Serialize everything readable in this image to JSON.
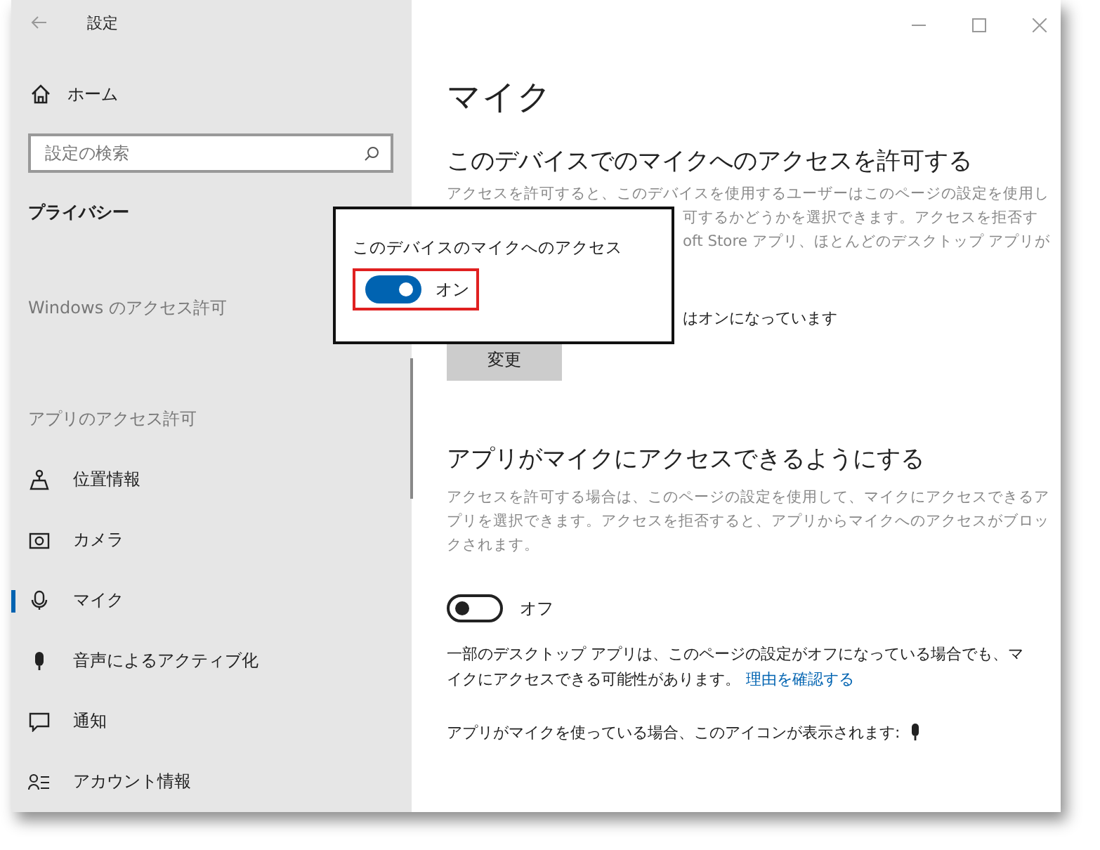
{
  "window": {
    "title": "設定"
  },
  "sidebar": {
    "home": "ホーム",
    "search": {
      "placeholder": "設定の検索"
    },
    "section": "プライバシー",
    "group_1": "Windows のアクセス許可",
    "group_2": "アプリのアクセス許可",
    "items": [
      {
        "label": "位置情報",
        "selected": false
      },
      {
        "label": "カメラ",
        "selected": false
      },
      {
        "label": "マイク",
        "selected": true
      },
      {
        "label": "音声によるアクティブ化",
        "selected": false
      },
      {
        "label": "通知",
        "selected": false
      },
      {
        "label": "アカウント情報",
        "selected": false
      }
    ]
  },
  "main": {
    "title": "マイク",
    "section_1": {
      "heading": "このデバイスでのマイクへのアクセスを許可する",
      "visible_lines": [
        "アクセスを許可すると、このデバイスを使用するユーザーはこのページの設定を使用し",
        "可するかどうかを選択できます。アクセスを拒否す",
        "oft Store アプリ、ほとんどのデスクトップ アプリが"
      ],
      "status": "はオンになっています",
      "button": "変更"
    },
    "section_2": {
      "heading": "アプリがマイクにアクセスできるようにする",
      "description": "アクセスを許可する場合は、このページの設定を使用して、マイクにアクセスできるアプリを選択できます。アクセスを拒否すると、アプリからマイクへのアクセスがブロックされます。",
      "toggle": {
        "on": false,
        "label": "オフ"
      },
      "note": "一部のデスクトップ アプリは、このページの設定がオフになっている場合でも、マイクにアクセスできる可能性があります。",
      "link": "理由を確認する",
      "icon_note": "アプリがマイクを使っている場合、このアイコンが表示されます:"
    }
  },
  "popup": {
    "title": "このデバイスのマイクへのアクセス",
    "toggle": {
      "on": true,
      "label": "オン"
    }
  }
}
